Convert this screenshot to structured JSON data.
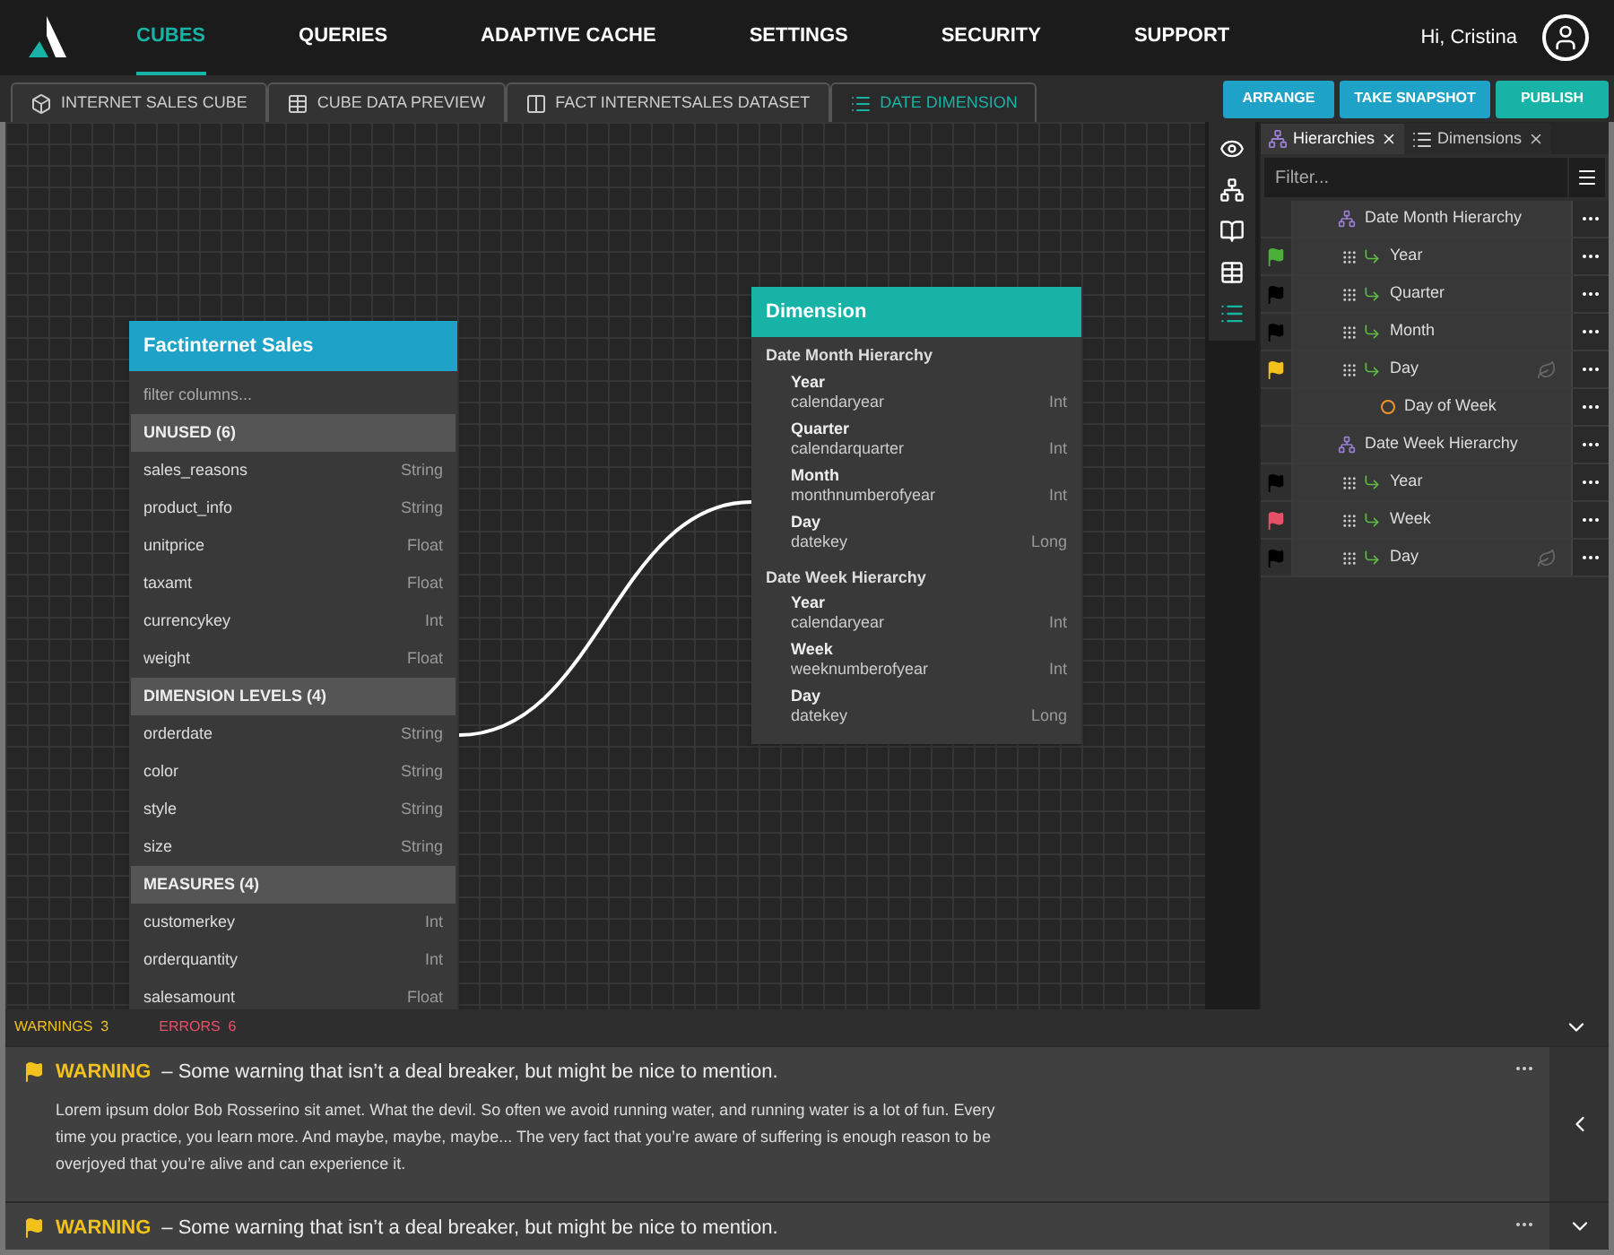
{
  "nav": {
    "items": [
      {
        "label": "CUBES",
        "selected": true
      },
      {
        "label": "QUERIES",
        "selected": false
      },
      {
        "label": "ADAPTIVE CACHE",
        "selected": false
      },
      {
        "label": "SETTINGS",
        "selected": false
      },
      {
        "label": "SECURITY",
        "selected": false
      },
      {
        "label": "SUPPORT",
        "selected": false
      }
    ],
    "greeting": "Hi, Cristina"
  },
  "tabs": [
    {
      "label": "INTERNET SALES CUBE",
      "kind": "cube",
      "selected": false
    },
    {
      "label": "CUBE DATA PREVIEW",
      "kind": "table",
      "selected": false
    },
    {
      "label": "FACT INTERNETSALES DATASET",
      "kind": "dataset",
      "selected": false
    },
    {
      "label": "DATE DIMENSION",
      "kind": "list",
      "selected": true
    }
  ],
  "actions": [
    {
      "label": "ARRANGE",
      "kind": "secondary"
    },
    {
      "label": "TAKE SNAPSHOT",
      "kind": "secondary"
    },
    {
      "label": "PUBLISH",
      "kind": "primary"
    }
  ],
  "fact_table": {
    "title": "Factinternet Sales",
    "filter_placeholder": "filter columns...",
    "sections": [
      {
        "title": "UNUSED (6)",
        "columns": [
          {
            "name": "sales_reasons",
            "type": "String"
          },
          {
            "name": "product_info",
            "type": "String"
          },
          {
            "name": "unitprice",
            "type": "Float"
          },
          {
            "name": "taxamt",
            "type": "Float"
          },
          {
            "name": "currencykey",
            "type": "Int"
          },
          {
            "name": "weight",
            "type": "Float"
          }
        ]
      },
      {
        "title": "DIMENSION LEVELS (4)",
        "columns": [
          {
            "name": "orderdate",
            "type": "String"
          },
          {
            "name": "color",
            "type": "String"
          },
          {
            "name": "style",
            "type": "String"
          },
          {
            "name": "size",
            "type": "String"
          }
        ]
      },
      {
        "title": "MEASURES (4)",
        "columns": [
          {
            "name": "customerkey",
            "type": "Int"
          },
          {
            "name": "orderquantity",
            "type": "Int"
          },
          {
            "name": "salesamount",
            "type": "Float"
          }
        ]
      }
    ]
  },
  "dimension": {
    "title": "Dimension",
    "hierarchies": [
      {
        "title": "Date Month Hierarchy",
        "levels": [
          {
            "name": "Year",
            "column": "calendaryear",
            "type": "Int"
          },
          {
            "name": "Quarter",
            "column": "calendarquarter",
            "type": "Int"
          },
          {
            "name": "Month",
            "column": "monthnumberofyear",
            "type": "Int"
          },
          {
            "name": "Day",
            "column": "datekey",
            "type": "Long"
          }
        ]
      },
      {
        "title": "Date Week Hierarchy",
        "levels": [
          {
            "name": "Year",
            "column": "calendaryear",
            "type": "Int"
          },
          {
            "name": "Week",
            "column": "weeknumberofyear",
            "type": "Int"
          },
          {
            "name": "Day",
            "column": "datekey",
            "type": "Long"
          }
        ]
      }
    ]
  },
  "side_tools": [
    {
      "kind": "eye",
      "selected": false
    },
    {
      "kind": "hierarchy",
      "selected": false
    },
    {
      "kind": "book",
      "selected": false
    },
    {
      "kind": "table",
      "selected": false
    },
    {
      "kind": "list",
      "selected": true
    }
  ],
  "panel": {
    "tabs": [
      {
        "label": "Hierarchies",
        "kind": "hierarchy",
        "selected": true
      },
      {
        "label": "Dimensions",
        "kind": "list",
        "selected": false
      }
    ],
    "filter_placeholder": "Filter...",
    "rows": [
      {
        "kind": "hierarchy",
        "label": "Date Month Hierarchy"
      },
      {
        "kind": "level",
        "label": "Year",
        "color": "#4caf3a",
        "leaf": false
      },
      {
        "kind": "level",
        "label": "Quarter",
        "color": "#000000",
        "leaf": false
      },
      {
        "kind": "level",
        "label": "Month",
        "color": "#000000",
        "leaf": false
      },
      {
        "kind": "level",
        "label": "Day",
        "color": "#f2c21b",
        "leaf": true
      },
      {
        "kind": "attribute",
        "label": "Day of Week"
      },
      {
        "kind": "hierarchy",
        "label": "Date Week Hierarchy"
      },
      {
        "kind": "level",
        "label": "Year",
        "color": "#000000",
        "leaf": false
      },
      {
        "kind": "level",
        "label": "Week",
        "color": "#e8506a",
        "leaf": false
      },
      {
        "kind": "level",
        "label": "Day",
        "color": "#000000",
        "leaf": true
      }
    ]
  },
  "issues": {
    "warnings_label": "WARNINGS",
    "warnings_count": "3",
    "errors_label": "ERRORS",
    "errors_count": "6",
    "items": [
      {
        "label": "WARNING",
        "message": "– Some warning that isn’t a deal breaker, but might be nice to mention.",
        "body": "Lorem ipsum dolor Bob Rosserino sit amet. What the devil. So often we avoid running water, and running water is a lot of fun. Every time you practice, you learn more. And maybe, maybe, maybe... The very fact that you’re aware of suffering is enough reason to be overjoyed that you’re alive and can experience it.",
        "expanded": true
      },
      {
        "label": "WARNING",
        "message": "– Some warning that isn’t a deal breaker, but might be nice to mention.",
        "expanded": false
      }
    ]
  }
}
